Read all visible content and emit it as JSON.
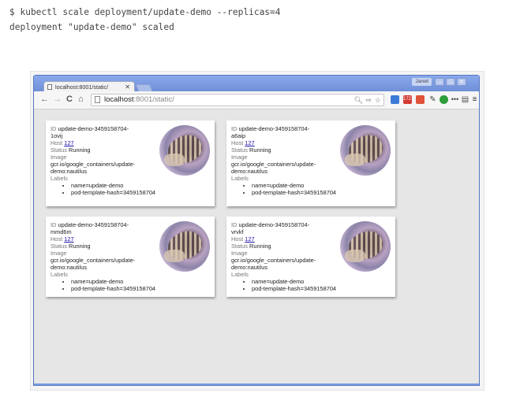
{
  "terminal": {
    "lines": [
      "$ kubectl scale deployment/update-demo --replicas=4",
      "deployment \"update-demo\" scaled"
    ]
  },
  "browser": {
    "tab_title": "localhost:8001/static/",
    "user": "Janet",
    "url_host": "localhost",
    "url_rest": ":8001/static/",
    "ext_badge": "1721"
  },
  "labels": {
    "id": "ID",
    "host": "Host",
    "status": "Status",
    "image": "Image",
    "labels": "Labels"
  },
  "pods": [
    {
      "id_line1": "update-demo-3459158704-",
      "id_line2": "1ovij",
      "host": "127",
      "status": "Running",
      "image_line1": "gcr.io/google_containers/update-",
      "image_line2": "demo:nautilus",
      "label1": "name=update-demo",
      "label2": "pod-template-hash=3459158704"
    },
    {
      "id_line1": "update-demo-3459158704-",
      "id_line2": "a6aip",
      "host": "127",
      "status": "Running",
      "image_line1": "gcr.io/google_containers/update-",
      "image_line2": "demo:nautilus",
      "label1": "name=update-demo",
      "label2": "pod-template-hash=3459158704"
    },
    {
      "id_line1": "update-demo-3459158704-",
      "id_line2": "mmd6m",
      "host": "127",
      "status": "Running",
      "image_line1": "gcr.io/google_containers/update-",
      "image_line2": "demo:nautilus",
      "label1": "name=update-demo",
      "label2": "pod-template-hash=3459158704"
    },
    {
      "id_line1": "update-demo-3459158704-",
      "id_line2": "vrvkf",
      "host": "127",
      "status": "Running",
      "image_line1": "gcr.io/google_containers/update-",
      "image_line2": "demo:nautilus",
      "label1": "name=update-demo",
      "label2": "pod-template-hash=3459158704"
    }
  ]
}
